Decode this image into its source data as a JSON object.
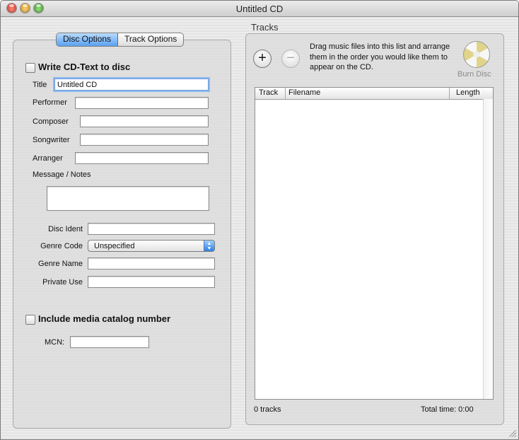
{
  "window": {
    "title": "Untitled CD"
  },
  "tabs": [
    {
      "label": "Disc Options",
      "selected": true
    },
    {
      "label": "Track Options",
      "selected": false
    }
  ],
  "disc_options": {
    "write_cd_text": {
      "label": "Write CD-Text to disc",
      "checked": false
    },
    "title": {
      "label": "Title",
      "value": "Untitled CD"
    },
    "performer": {
      "label": "Performer",
      "value": ""
    },
    "composer": {
      "label": "Composer",
      "value": ""
    },
    "songwriter": {
      "label": "Songwriter",
      "value": ""
    },
    "arranger": {
      "label": "Arranger",
      "value": ""
    },
    "message_notes": {
      "label": "Message / Notes",
      "value": ""
    },
    "disc_ident": {
      "label": "Disc Ident",
      "value": ""
    },
    "genre_code": {
      "label": "Genre Code",
      "value": "Unspecified"
    },
    "genre_name": {
      "label": "Genre Name",
      "value": ""
    },
    "private_use": {
      "label": "Private Use",
      "value": ""
    },
    "include_mcn": {
      "label": "Include media catalog number",
      "checked": false
    },
    "mcn": {
      "label": "MCN:",
      "value": ""
    }
  },
  "tracks": {
    "heading": "Tracks",
    "add_icon": "plus-icon",
    "remove_icon": "minus-icon",
    "hint": "Drag music files into this list and arrange them in the order you would like them to appear on the CD.",
    "burn_label": "Burn Disc",
    "columns": [
      "Track",
      "Filename",
      "Length"
    ],
    "rows": [],
    "count_text": "0 tracks",
    "total_time": "Total time: 0:00"
  },
  "colors": {
    "accent": "#5aa0ef",
    "focus_ring": "#8fb9ef"
  }
}
